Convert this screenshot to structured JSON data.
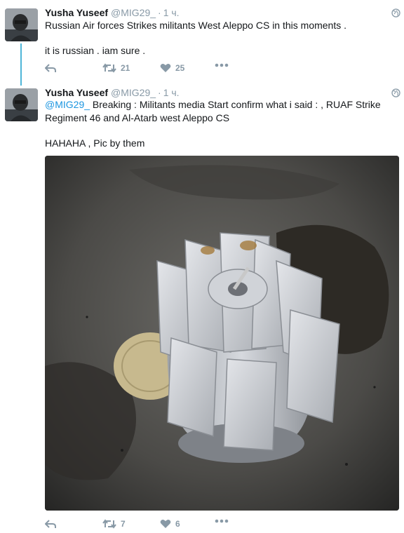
{
  "tweets": [
    {
      "author_name": "Yusha Yuseef",
      "author_handle": "@MIG29_",
      "separator": "·",
      "time": "1 ч.",
      "text_line1": "Russian Air forces Strikes  militants West Aleppo CS in this moments .",
      "text_line2": "it is russian . iam sure .",
      "retweets": "21",
      "likes": "25"
    },
    {
      "author_name": "Yusha Yuseef",
      "author_handle": "@MIG29_",
      "separator": "·",
      "time": "1 ч.",
      "mention": "@MIG29_",
      "text_line1_rest": " Breaking : Militants media Start confirm what i said : , RUAF Strike",
      "text_line2": "Regiment 46 and Al-Atarb west Aleppo CS",
      "text_line3": "HAHAHA , Pic by them",
      "retweets": "7",
      "likes": "6"
    }
  ],
  "colors": {
    "text": "#14171a",
    "muted": "#8899a6",
    "link": "#1b95e0",
    "thread_line": "#4fb6d8"
  },
  "icons": [
    "avatar",
    "globe-icon",
    "reply-icon",
    "retweet-icon",
    "like-icon",
    "more-icon"
  ]
}
